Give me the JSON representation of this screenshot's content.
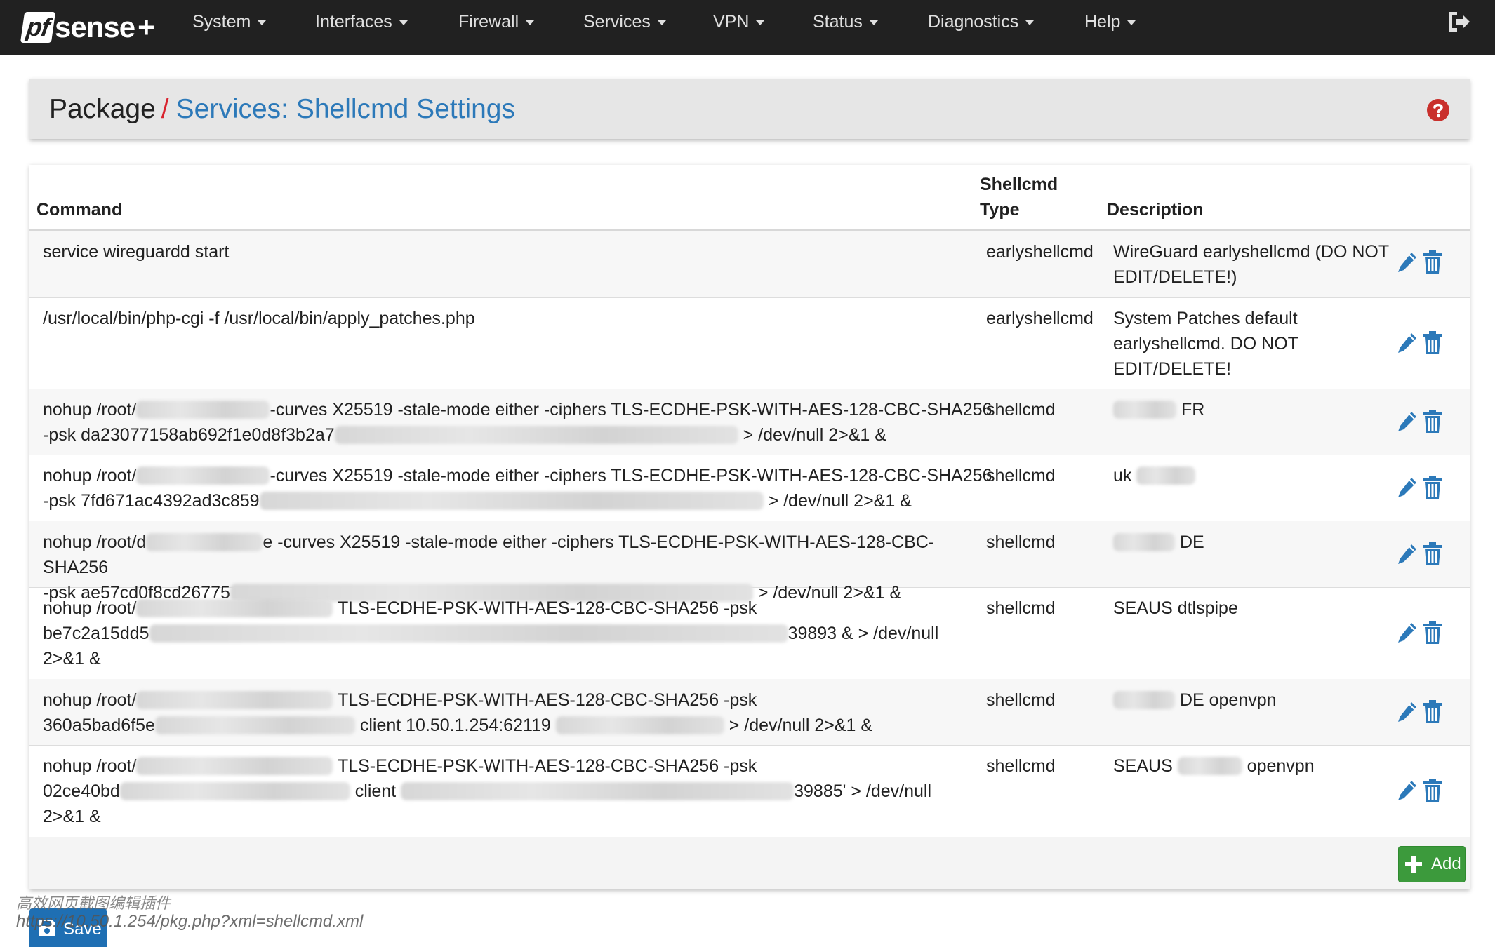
{
  "navbar": {
    "logo": {
      "pf": "pf",
      "sense": "sense",
      "plus": "+"
    },
    "menu": [
      {
        "label": "System"
      },
      {
        "label": "Interfaces"
      },
      {
        "label": "Firewall"
      },
      {
        "label": "Services"
      },
      {
        "label": "VPN"
      },
      {
        "label": "Status"
      },
      {
        "label": "Diagnostics"
      },
      {
        "label": "Help"
      }
    ],
    "logout_icon": "logout-icon"
  },
  "breadcrumb": {
    "root": "Package",
    "separator": "/",
    "current": "Services: Shellcmd Settings",
    "help_icon": "question-circle-icon"
  },
  "table": {
    "headers": {
      "command": "Command",
      "type_line1": "Shellcmd",
      "type_line2": "Type",
      "description": "Description"
    },
    "rows": [
      {
        "cmd": [
          "service wireguardd start"
        ],
        "type": "earlyshellcmd",
        "desc": [
          "WireGuard earlyshellcmd (DO NOT",
          "EDIT/DELETE!)"
        ]
      },
      {
        "cmd": [
          "/usr/local/bin/php-cgi -f /usr/local/bin/apply_patches.php"
        ],
        "type": "earlyshellcmd",
        "desc": [
          "System Patches default",
          "earlyshellcmd. DO NOT",
          "EDIT/DELETE!"
        ]
      },
      {
        "cmd_a": "nohup /root/",
        "cmd_b": "-curves X25519 -stale-mode either -ciphers TLS-ECDHE-PSK-WITH-AES-128-CBC-SHA256",
        "cmd_c": "-psk da23077158ab692f1e0d8f3b2a7",
        "cmd_d": "> /dev/null 2>&1 &",
        "type": "shellcmd",
        "desc_a": "FR"
      },
      {
        "cmd_a": "nohup /root/",
        "cmd_b": "-curves X25519 -stale-mode either -ciphers TLS-ECDHE-PSK-WITH-AES-128-CBC-SHA256",
        "cmd_c": "-psk 7fd671ac4392ad3c859",
        "cmd_d": "> /dev/null 2>&1 &",
        "type": "shellcmd",
        "desc_a": "uk"
      },
      {
        "cmd_a": "nohup /root/d",
        "cmd_b": "e -curves X25519 -stale-mode either -ciphers TLS-ECDHE-PSK-WITH-AES-128-CBC-SHA256",
        "cmd_c": "-psk ae57cd0f8cd26775",
        "cmd_d": "> /dev/null 2>&1 &",
        "type": "shellcmd",
        "desc_a": "DE"
      },
      {
        "cmd_a": "nohup /root/",
        "cmd_b": "TLS-ECDHE-PSK-WITH-AES-128-CBC-SHA256 -psk",
        "cmd_c": "be7c2a15dd5",
        "cmd_d": "39893 & > /dev/null",
        "cmd_e": "2>&1 &",
        "type": "shellcmd",
        "desc_a": "SEAUS dtlspipe"
      },
      {
        "cmd_a": "nohup /root/",
        "cmd_b": "TLS-ECDHE-PSK-WITH-AES-128-CBC-SHA256 -psk",
        "cmd_c": "360a5bad6f5e",
        "cmd_d": "client 10.50.1.254:62119",
        "cmd_e": "> /dev/null 2>&1 &",
        "type": "shellcmd",
        "desc_a": "DE openvpn"
      },
      {
        "cmd_a": "nohup /root/",
        "cmd_b": "TLS-ECDHE-PSK-WITH-AES-128-CBC-SHA256 -psk",
        "cmd_c": "02ce40bd",
        "cmd_d": "client",
        "cmd_e": "39885' > /dev/null",
        "cmd_f": "2>&1 &",
        "type": "shellcmd",
        "desc_a": "SEAUS",
        "desc_b": "openvpn"
      }
    ],
    "add_label": "Add"
  },
  "bottom": {
    "save_label": "Save",
    "watermark": "高效网页截图编辑插件",
    "status_url": "https://10.50.1.254/pkg.php?xml=shellcmd.xml"
  },
  "colors": {
    "navbar_bg": "#212121",
    "link_blue": "#2c79b9",
    "crumb_separator": "#d9232e",
    "add_green": "#3c9a3c",
    "save_blue": "#1f6fb3",
    "help_red": "#c9302c"
  }
}
